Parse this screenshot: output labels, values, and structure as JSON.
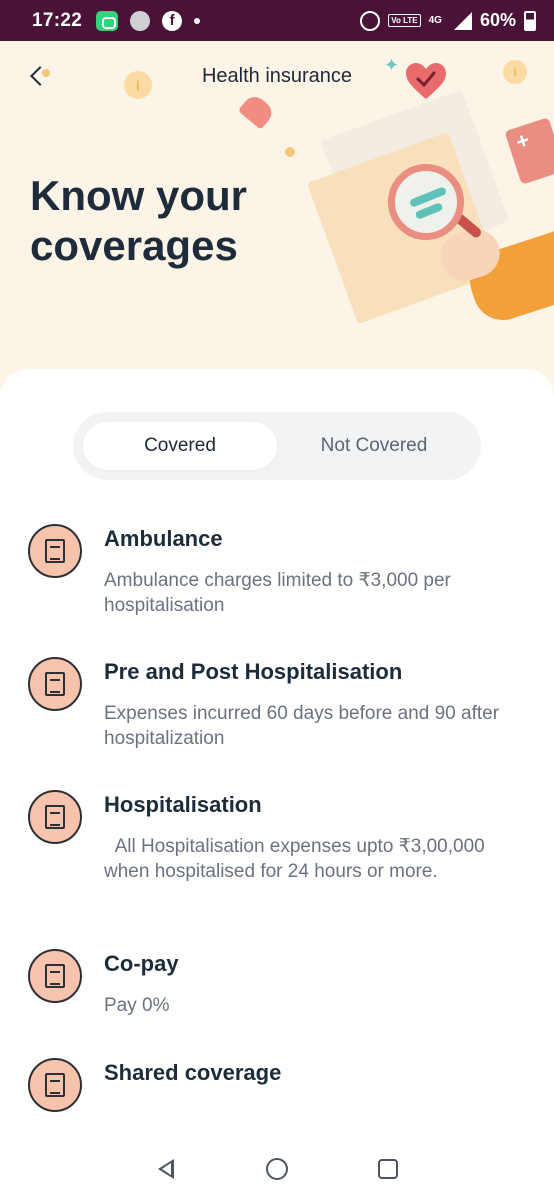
{
  "status_bar": {
    "time": "17:22",
    "battery": "60%",
    "network": "4G",
    "lte_label": "Vo LTE"
  },
  "header": {
    "title": "Health insurance"
  },
  "hero": {
    "title": "Know your coverages"
  },
  "tabs": [
    {
      "label": "Covered",
      "active": true
    },
    {
      "label": "Not Covered",
      "active": false
    }
  ],
  "coverages": [
    {
      "title": "Ambulance",
      "description": "Ambulance charges limited to ₹3,000 per hospitalisation",
      "icon": "document-icon"
    },
    {
      "title": "Pre and Post Hospitalisation",
      "description": "Expenses incurred 60 days before and 90 after hospitalization",
      "icon": "document-icon"
    },
    {
      "title": "Hospitalisation",
      "description": "  All Hospitalisation expenses upto ₹3,00,000 when hospitalised for 24 hours or more.",
      "icon": "document-icon"
    },
    {
      "title": "Co-pay",
      "description": "Pay 0%",
      "icon": "document-icon"
    },
    {
      "title": "Shared coverage",
      "description": "",
      "icon": "document-icon"
    }
  ],
  "colors": {
    "hero_bg": "#fdf4e8",
    "icon_bg": "#f7c3ac",
    "status_bar": "#4a1237",
    "title_text": "#1d2b3a"
  }
}
